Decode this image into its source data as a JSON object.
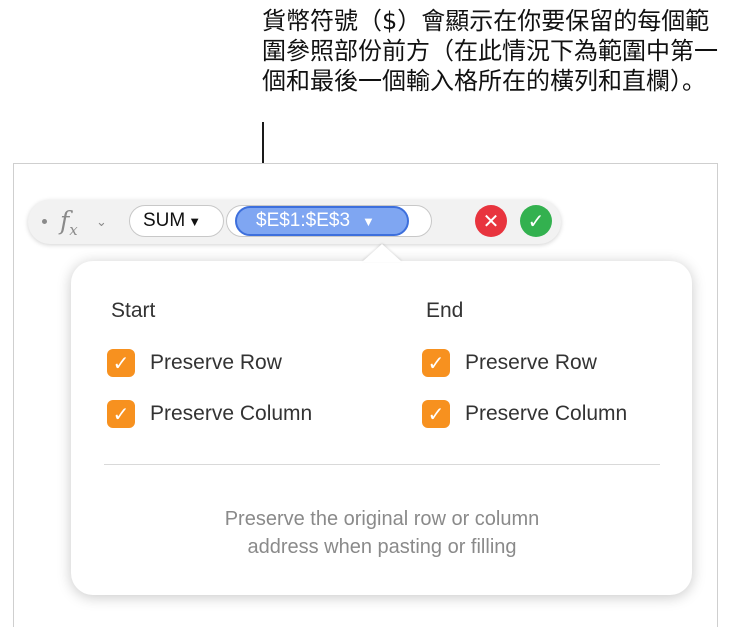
{
  "callout": {
    "text": "貨幣符號（$）會顯示在你要保留的每個範圍參照部份前方（在此情況下為範圍中第一個和最後一個輸入格所在的橫列和直欄）。"
  },
  "formula_bar": {
    "fx_symbol": "f",
    "fx_sub": "x",
    "fx_chevron": "⌄",
    "function_name": "SUM",
    "function_chevron": "▼",
    "reference": "$E$1:$E$3",
    "reference_chevron": "▼",
    "cancel_icon": "✕",
    "accept_icon": "✓"
  },
  "popover": {
    "start": {
      "heading": "Start",
      "preserve_row": "Preserve Row",
      "preserve_column": "Preserve Column"
    },
    "end": {
      "heading": "End",
      "preserve_row": "Preserve Row",
      "preserve_column": "Preserve Column"
    },
    "checkmark": "✓",
    "help_line1": "Preserve the original row or column",
    "help_line2": "address when pasting or filling"
  },
  "colors": {
    "reference_token_fill": "#7fa6f2",
    "reference_token_border": "#3d6fdc",
    "checkbox": "#f7911f",
    "cancel": "#e8343e",
    "accept": "#33b14f"
  }
}
